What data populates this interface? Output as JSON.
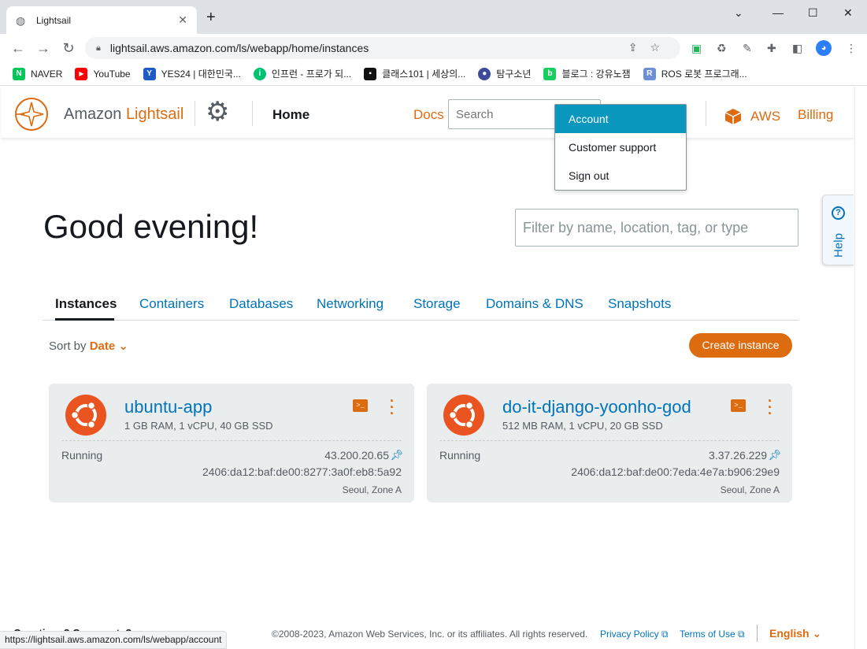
{
  "browser": {
    "tab_title": "Lightsail",
    "tab_close": "✕",
    "new_tab": "+",
    "url": "lightsail.aws.amazon.com/ls/webapp/home/instances",
    "bookmarks": [
      {
        "label": "NAVER",
        "color": "#03c75a",
        "glyph": "N"
      },
      {
        "label": "YouTube",
        "color": "#ff0000",
        "glyph": "▶"
      },
      {
        "label": "YES24 | 대한민국...",
        "color": "#1e5bc6",
        "glyph": "Y"
      },
      {
        "label": "인프런 - 프로가 되...",
        "color": "#00c471",
        "glyph": "i"
      },
      {
        "label": "클래스101 | 세상의...",
        "color": "#111111",
        "glyph": "▪"
      },
      {
        "label": "탐구소년",
        "color": "#3b4a9b",
        "glyph": "●"
      },
      {
        "label": "블로그 : 강유노잼",
        "color": "#19ce60",
        "glyph": "b"
      },
      {
        "label": "ROS 로봇 프로그래...",
        "color": "#6d8fd6",
        "glyph": "R"
      }
    ],
    "status_url": "https://lightsail.aws.amazon.com/ls/webapp/account"
  },
  "header": {
    "brand_prefix": "Amazon ",
    "brand_suffix": "Lightsail",
    "home": "Home",
    "docs": "Docs",
    "search_placeholder": "Search",
    "aws": "AWS",
    "billing": "Billing"
  },
  "account_menu": {
    "items": [
      "Account",
      "Customer support",
      "Sign out"
    ]
  },
  "main": {
    "greeting": "Good evening!",
    "filter_placeholder": "Filter by name, location, tag, or type",
    "help": "Help",
    "tabs": [
      "Instances",
      "Containers",
      "Databases",
      "Networking",
      "Storage",
      "Domains & DNS",
      "Snapshots"
    ],
    "active_tab": "Instances",
    "sort_label": "Sort by ",
    "sort_value": "Date",
    "create_button": "Create instance"
  },
  "instances": [
    {
      "name": "ubuntu-app",
      "specs": "1 GB RAM, 1 vCPU, 40 GB SSD",
      "state": "Running",
      "ipv4": "43.200.20.65",
      "ipv6": "2406:da12:baf:de00:8277:3a0f:eb8:5a92",
      "zone": "Seoul, Zone A"
    },
    {
      "name": "do-it-django-yoonho-god",
      "specs": "512 MB RAM, 1 vCPU, 20 GB SSD",
      "state": "Running",
      "ipv4": "3.37.26.229",
      "ipv6": "2406:da12:baf:de00:7eda:4e7a:b906:29e9",
      "zone": "Seoul, Zone A"
    }
  ],
  "footer": {
    "questions": "Questions? Comments?",
    "copyright": "©2008-2023, Amazon Web Services, Inc. or its affiliates. All rights reserved.",
    "privacy": "Privacy Policy",
    "terms": "Terms of Use",
    "language": "English"
  },
  "colors": {
    "accent": "#dd6b10",
    "link": "#0073bb",
    "menu_active": "#0a97be",
    "ubuntu": "#e95420"
  }
}
